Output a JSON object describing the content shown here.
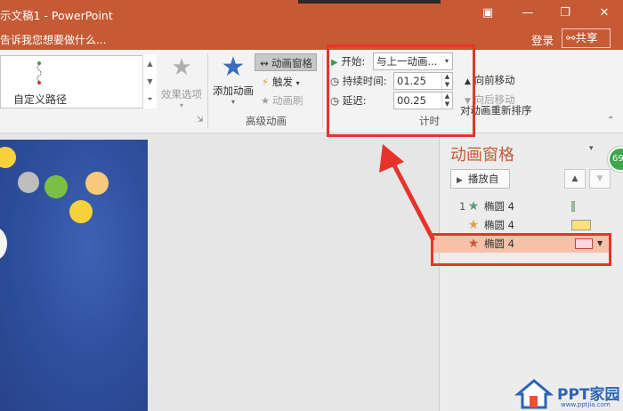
{
  "window": {
    "title": "示文稿1 - PowerPoint",
    "tell_me": "告诉我您想要做什么...",
    "login": "登录",
    "share": "共享"
  },
  "ribbon": {
    "gallery_item_label": "自定义路径",
    "effect_options": "效果选项",
    "add_animation": "添加动画",
    "animation_pane_btn": "动画窗格",
    "trigger": "触发",
    "animation_painter": "动画刷",
    "advanced_group": "高级动画",
    "timing": {
      "start_label": "开始:",
      "start_value": "与上一动画...",
      "duration_label": "持续时间:",
      "duration_value": "01.25",
      "delay_label": "延迟:",
      "delay_value": "00.25",
      "group_label": "计时"
    },
    "reorder_title": "对动画重新排序",
    "move_earlier": "向前移动",
    "move_later": "向后移动"
  },
  "pane": {
    "title": "动画窗格",
    "play_from": "播放自",
    "badge": "69",
    "items": [
      {
        "num": "1",
        "name": "椭圆 4",
        "star_color": "#5a9a78",
        "bar_color": "#8fd18f",
        "selected": false
      },
      {
        "num": "",
        "name": "椭圆 4",
        "star_color": "#e0a040",
        "bar_color": "#ffe07a",
        "selected": false
      },
      {
        "num": "",
        "name": "椭圆 4",
        "star_color": "#c55a35",
        "bar_color": "#ffd6dc",
        "selected": true
      }
    ]
  },
  "watermark": {
    "text": "PPT家园",
    "url": "www.pptjia.com"
  },
  "colors": {
    "accent": "#c55a35",
    "highlight": "#e8332c"
  }
}
